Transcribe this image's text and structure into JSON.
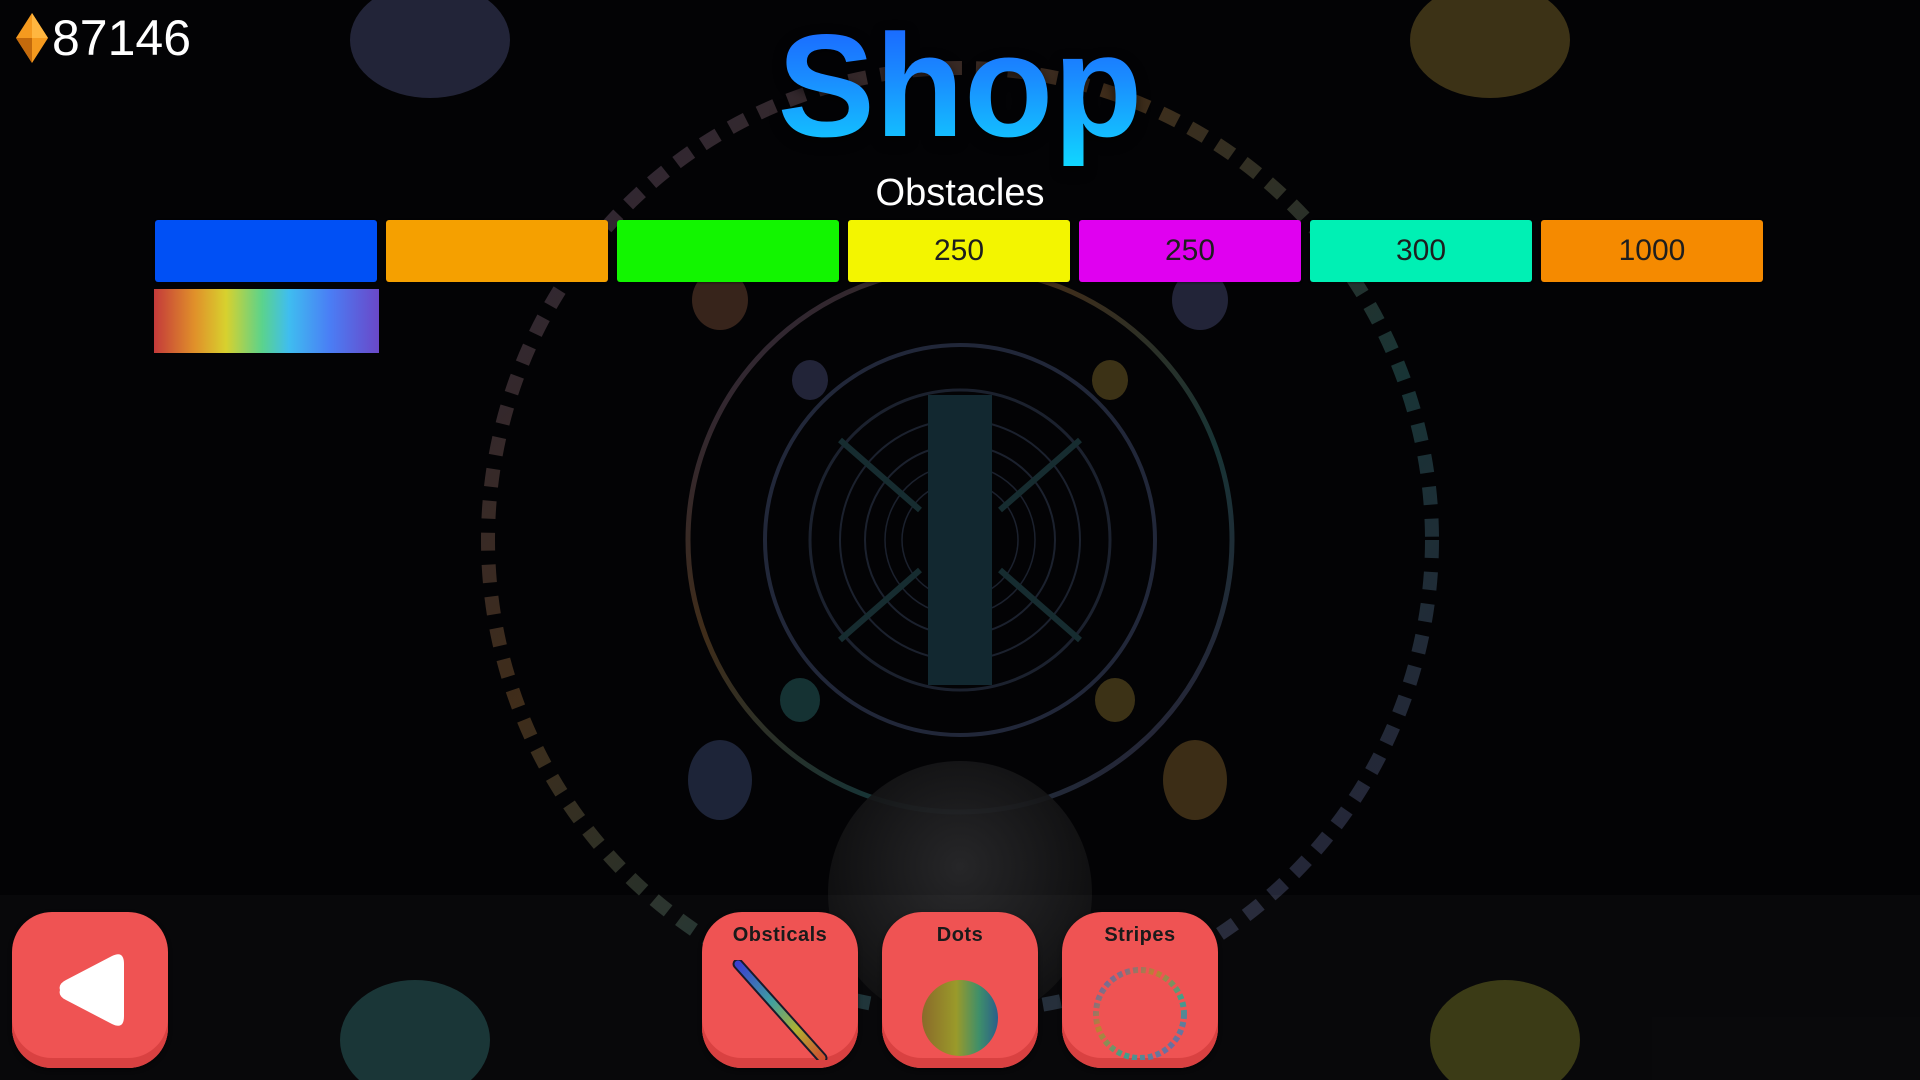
{
  "currency": {
    "amount": "87146",
    "icon": "gem-icon",
    "color": "#f59a1f"
  },
  "shop": {
    "title": "Shop",
    "section_label": "Obstacles"
  },
  "swatches": [
    {
      "color": "#0050f5",
      "price": ""
    },
    {
      "color": "#f5a000",
      "price": ""
    },
    {
      "color": "#12f500",
      "price": ""
    },
    {
      "color": "#f3f500",
      "price": "250"
    },
    {
      "color": "#e000f0",
      "price": "250"
    },
    {
      "color": "#00f0b4",
      "price": "300"
    },
    {
      "color": "#f58a00",
      "price": "1000"
    },
    {
      "color": "rainbow-gradient",
      "price": ""
    }
  ],
  "navigation": {
    "back_icon": "back-arrow-icon",
    "tabs": [
      {
        "label": "Obsticals",
        "icon": "obstacle-bar-icon"
      },
      {
        "label": "Dots",
        "icon": "dot-icon"
      },
      {
        "label": "Stripes",
        "icon": "stripe-ring-icon"
      }
    ]
  },
  "colors": {
    "button": "#ef5353",
    "title_gradient_top": "#1a5cff",
    "title_gradient_bottom": "#10d6ff"
  }
}
